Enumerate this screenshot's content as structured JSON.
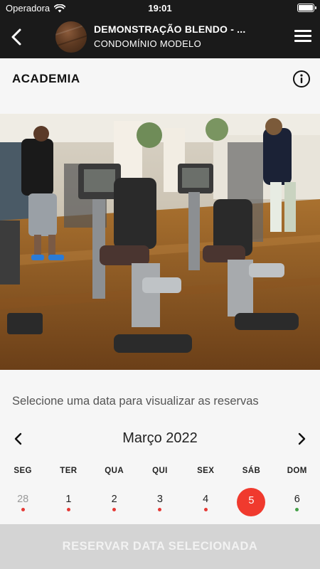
{
  "status_bar": {
    "carrier": "Operadora",
    "time": "19:01"
  },
  "navbar": {
    "title": "DEMONSTRAÇÃO BLENDO - ...",
    "subtitle": "CONDOMÍNIO MODELO"
  },
  "section": {
    "title": "ACADEMIA"
  },
  "calendar": {
    "prompt": "Selecione uma data para visualizar as reservas",
    "month_label": "Março 2022",
    "weekdays": [
      "SEG",
      "TER",
      "QUA",
      "QUI",
      "SEX",
      "SÁB",
      "DOM"
    ],
    "days": [
      {
        "label": "28",
        "muted": true,
        "dot": "#e53935"
      },
      {
        "label": "1",
        "muted": false,
        "dot": "#e53935"
      },
      {
        "label": "2",
        "muted": false,
        "dot": "#e53935"
      },
      {
        "label": "3",
        "muted": false,
        "dot": "#e53935"
      },
      {
        "label": "4",
        "muted": false,
        "dot": "#e53935"
      },
      {
        "label": "5",
        "muted": false,
        "selected": true,
        "dot": null
      },
      {
        "label": "6",
        "muted": false,
        "dot": "#43a047"
      }
    ],
    "selected_color": "#f03a2e"
  },
  "actions": {
    "reserve_label": "RESERVAR DATA SELECIONADA"
  }
}
